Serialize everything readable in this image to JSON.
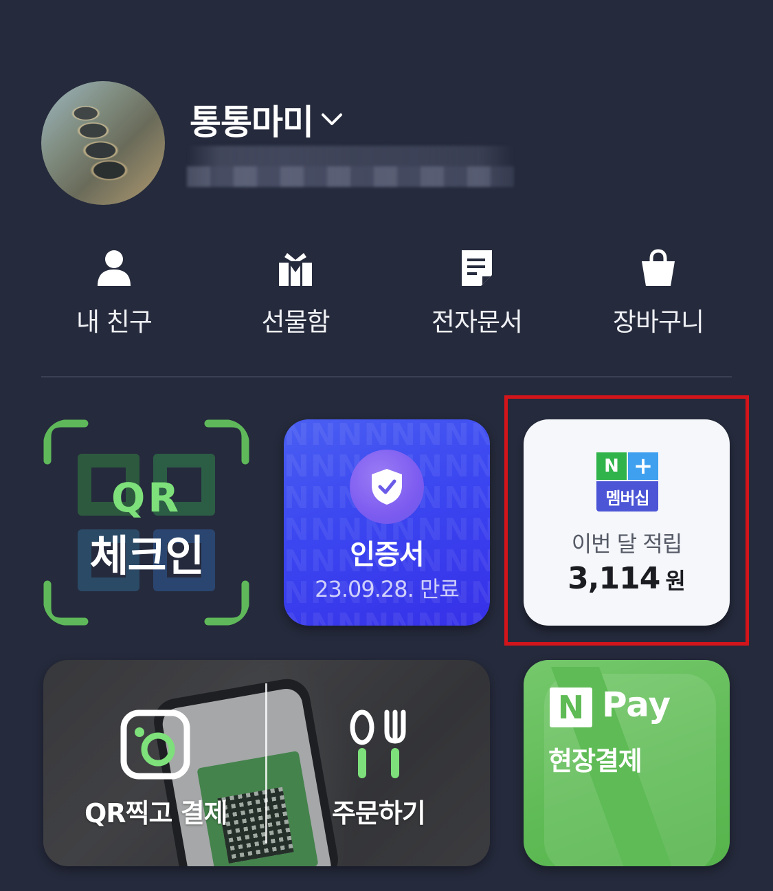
{
  "profile": {
    "name": "통통마미",
    "icons": {
      "expand": "chevron-down-icon"
    }
  },
  "quick_menu": [
    {
      "label": "내 친구",
      "icon": "person-icon"
    },
    {
      "label": "선물함",
      "icon": "gift-icon"
    },
    {
      "label": "전자문서",
      "icon": "document-icon"
    },
    {
      "label": "장바구니",
      "icon": "shopping-bag-icon"
    }
  ],
  "tiles": {
    "qr_checkin": {
      "line1": "QR",
      "line2": "체크인",
      "accent": "#5fb95a"
    },
    "certificate": {
      "title": "인증서",
      "expiry": "23.09.28. 만료",
      "accent": "#3b46f0",
      "icon": "shield-check-icon"
    },
    "membership": {
      "logo_n": "N",
      "logo_plus": "+",
      "logo_text": "멤버십",
      "label": "이번 달 적립",
      "amount": "3,114",
      "unit": "원",
      "highlight_color": "#d3151b"
    },
    "qr_pay": {
      "qr_pay_label": "QR찍고 결제",
      "order_label": "주문하기",
      "icons": [
        "camera-icon",
        "fork-spoon-icon"
      ]
    },
    "npay": {
      "logo": "N",
      "brand": "Pay",
      "subtitle": "현장결제",
      "accent": "#5fbb55"
    }
  }
}
